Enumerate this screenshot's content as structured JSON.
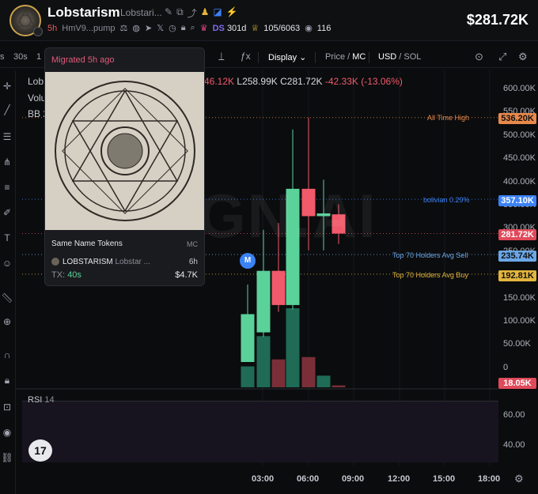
{
  "header": {
    "token_name": "Lobstarism",
    "token_sub": "Lobstari...",
    "age": "5h",
    "address": "HmV9...pump",
    "ds_label": "DS",
    "ds_value": "301d",
    "holders": "105/6063",
    "views": "116",
    "price": "$281.72K"
  },
  "toolbar": {
    "interval_s": "s",
    "interval_30s": "30s",
    "interval_1": "1",
    "display": "Display",
    "price_label": "Price",
    "mc_label": "MC",
    "usd_label": "USD",
    "sol_label": "SOL"
  },
  "legend": {
    "name": "Lob",
    "volume": "Volu",
    "bb": "BB 2",
    "ohlc_partial": "46.12K",
    "low": "L258.99K",
    "close": "C281.72K",
    "change": "-42.33K (-13.06%)"
  },
  "watermark": "GN.AI",
  "price_lines": {
    "ath_label": "All Time High",
    "bolivian_label": "bolivian 0.29%",
    "sell_label": "Top 70 Holders Avg Sell",
    "buy_label": "Top 70 Holders Avg Buy"
  },
  "axis": {
    "ticks": [
      "600.00K",
      "550.00K",
      "500.00K",
      "450.00K",
      "400.00K",
      "350.00K",
      "300.00K",
      "250.00K",
      "200.00K",
      "150.00K",
      "100.00K",
      "50.00K",
      "0"
    ],
    "ath_tag": "536.20K",
    "bolivian_tag": "357.10K",
    "price_tag": "281.72K",
    "sell_tag": "235.74K",
    "buy_tag": "192.81K",
    "vol_tag": "18.05K"
  },
  "rsi": {
    "label": "RSI",
    "period": "14",
    "tick_60": "60.00",
    "tick_40": "40.00"
  },
  "time_axis": [
    "03:00",
    "06:00",
    "09:00",
    "12:00",
    "15:00",
    "18:00"
  ],
  "popup": {
    "title": "Migrated 5h ago",
    "same_name": "Same Name Tokens",
    "mc": "MC",
    "token_name": "LOBSTARISM",
    "token_sub": "Lobstar ...",
    "age": "6h",
    "tx_label": "TX:",
    "tx_value": "40s",
    "value": "$4.7K"
  },
  "marker": "M",
  "tv_logo": "17",
  "colors": {
    "up": "#5ad29a",
    "down": "#f05a6a",
    "ath": "#e8884a",
    "bolivian": "#3b82f6",
    "sell": "#6aa7e8",
    "buy": "#e2b53c",
    "price": "#e04a5a"
  },
  "chart_data": {
    "type": "candlestick",
    "candles": [
      {
        "time": "03:00",
        "open": 0,
        "high": 170000,
        "low": 0,
        "close": 105000
      },
      {
        "time": "03:30",
        "open": 65000,
        "high": 290000,
        "low": 55000,
        "close": 200000
      },
      {
        "time": "04:00",
        "open": 200000,
        "high": 305000,
        "low": 110000,
        "close": 125000
      },
      {
        "time": "05:00",
        "open": 125000,
        "high": 510000,
        "low": 115000,
        "close": 380000
      },
      {
        "time": "06:00",
        "open": 380000,
        "high": 536200,
        "low": 245000,
        "close": 320000
      },
      {
        "time": "06:30",
        "open": 320000,
        "high": 400000,
        "low": 245000,
        "close": 326000
      },
      {
        "time": "07:00",
        "open": 324000,
        "high": 346000,
        "low": 258990,
        "close": 281720
      }
    ],
    "volumes": [
      {
        "time": "03:00",
        "value": 45000,
        "dir": "up"
      },
      {
        "time": "03:30",
        "value": 110000,
        "dir": "up"
      },
      {
        "time": "04:00",
        "value": 60000,
        "dir": "down"
      },
      {
        "time": "05:00",
        "value": 170000,
        "dir": "up"
      },
      {
        "time": "06:00",
        "value": 65000,
        "dir": "down"
      },
      {
        "time": "06:30",
        "value": 25000,
        "dir": "up"
      },
      {
        "time": "07:00",
        "value": 4000,
        "dir": "down"
      }
    ],
    "ylim": [
      0,
      600000
    ],
    "reference_lines": [
      {
        "label": "All Time High",
        "value": 536200
      },
      {
        "label": "bolivian 0.29%",
        "value": 357100
      },
      {
        "label": "Top 70 Holders Avg Sell",
        "value": 235740
      },
      {
        "label": "Top 70 Holders Avg Buy",
        "value": 192810
      }
    ]
  }
}
